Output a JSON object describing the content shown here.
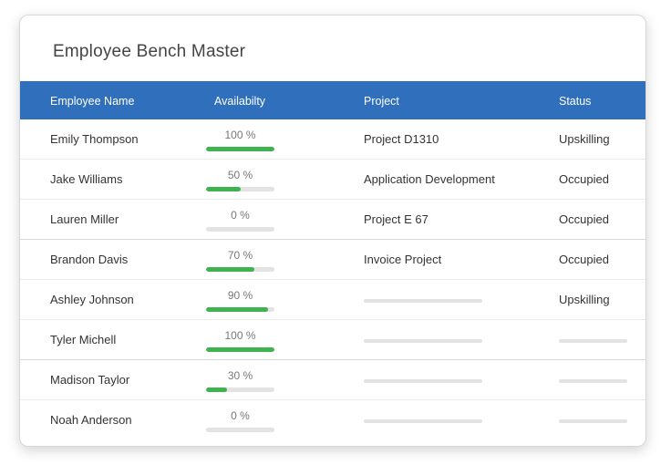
{
  "title": "Employee Bench Master",
  "columns": [
    "Employee Name",
    "Availabilty",
    "Project",
    "Status"
  ],
  "colors": {
    "header_bg": "#2f6fbc",
    "bar_fill": "#3fb34f",
    "bar_track": "#e3e3e3"
  },
  "rows": [
    {
      "name": "Emily Thompson",
      "availability_label": "100 %",
      "availability": 100,
      "project": "Project D1310",
      "status": "Upskilling"
    },
    {
      "name": "Jake Williams",
      "availability_label": "50 %",
      "availability": 50,
      "project": "Application Development",
      "status": "Occupied"
    },
    {
      "name": "Lauren Miller",
      "availability_label": "0 %",
      "availability": 0,
      "project": "Project E 67",
      "status": "Occupied"
    },
    {
      "name": "Brandon Davis",
      "availability_label": "70 %",
      "availability": 70,
      "project": "Invoice Project",
      "status": "Occupied"
    },
    {
      "name": "Ashley Johnson",
      "availability_label": "90 %",
      "availability": 90,
      "project": "",
      "status": "Upskilling"
    },
    {
      "name": "Tyler Michell",
      "availability_label": "100 %",
      "availability": 100,
      "project": "",
      "status": ""
    },
    {
      "name": "Madison Taylor",
      "availability_label": "30 %",
      "availability": 30,
      "project": "",
      "status": ""
    },
    {
      "name": "Noah Anderson",
      "availability_label": "0 %",
      "availability": 0,
      "project": "",
      "status": ""
    }
  ]
}
